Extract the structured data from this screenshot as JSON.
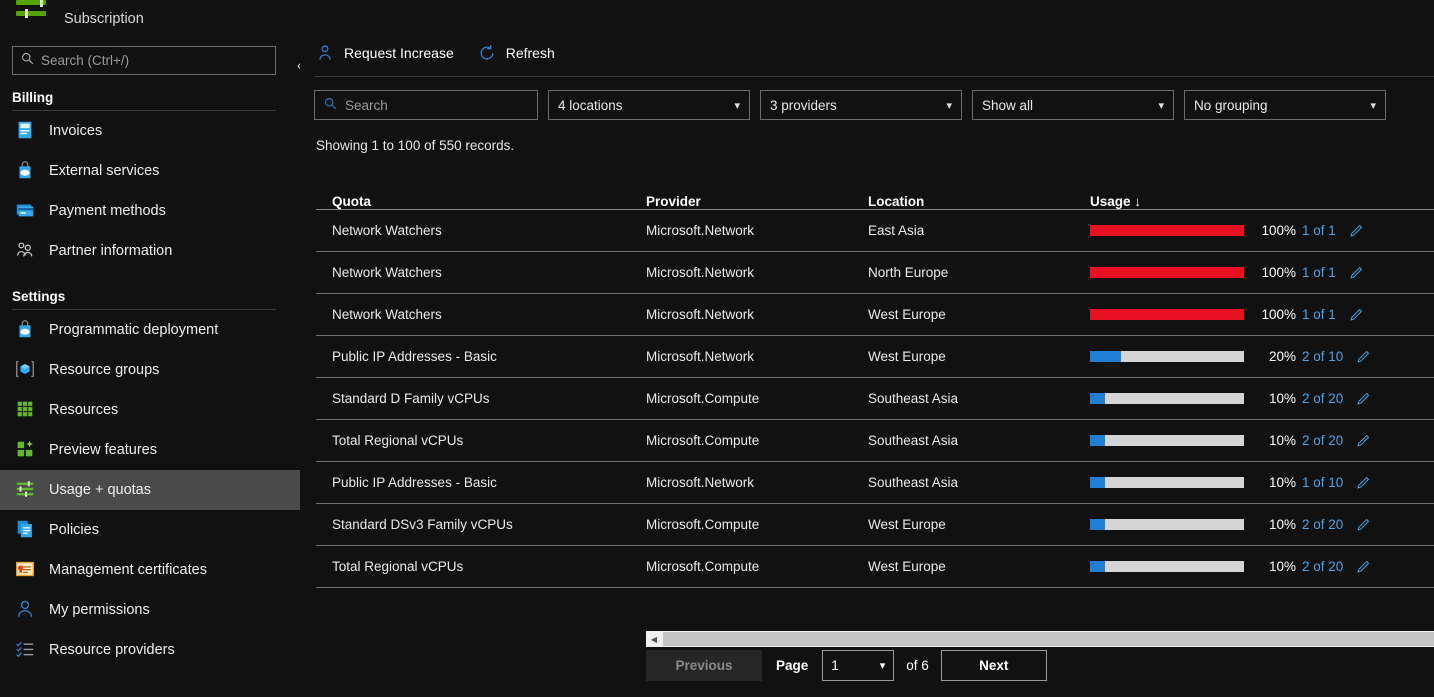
{
  "sidebar": {
    "subscription_label": "Subscription",
    "search_placeholder": "Search (Ctrl+/)",
    "search_value": "",
    "collapse_glyph": "«",
    "groups": [
      {
        "title": "Billing",
        "items": [
          {
            "label": "Invoices",
            "icon": "invoice-icon"
          },
          {
            "label": "External services",
            "icon": "external-services-icon"
          },
          {
            "label": "Payment methods",
            "icon": "payment-methods-icon"
          },
          {
            "label": "Partner information",
            "icon": "partner-information-icon"
          }
        ]
      },
      {
        "title": "Settings",
        "items": [
          {
            "label": "Programmatic deployment",
            "icon": "programmatic-deployment-icon"
          },
          {
            "label": "Resource groups",
            "icon": "resource-groups-icon"
          },
          {
            "label": "Resources",
            "icon": "resources-icon"
          },
          {
            "label": "Preview features",
            "icon": "preview-features-icon"
          },
          {
            "label": "Usage + quotas",
            "icon": "usage-quotas-icon",
            "selected": true
          },
          {
            "label": "Policies",
            "icon": "policies-icon"
          },
          {
            "label": "Management certificates",
            "icon": "management-certificates-icon"
          },
          {
            "label": "My permissions",
            "icon": "my-permissions-icon"
          },
          {
            "label": "Resource providers",
            "icon": "resource-providers-icon"
          }
        ]
      }
    ]
  },
  "toolbar": {
    "request_increase_label": "Request Increase",
    "refresh_label": "Refresh"
  },
  "filters": {
    "search_placeholder": "Search",
    "search_value": "",
    "locations": "4 locations",
    "providers": "3 providers",
    "show": "Show all",
    "grouping": "No grouping"
  },
  "records_text": "Showing 1 to 100 of 550 records.",
  "table": {
    "columns": [
      "Quota",
      "Provider",
      "Location",
      "Usage ↓"
    ],
    "rows": [
      {
        "quota": "Network Watchers",
        "provider": "Microsoft.Network",
        "location": "East Asia",
        "percent": "100%",
        "pct_value": 100,
        "fraction": "1 of 1",
        "color": "#e81123"
      },
      {
        "quota": "Network Watchers",
        "provider": "Microsoft.Network",
        "location": "North Europe",
        "percent": "100%",
        "pct_value": 100,
        "fraction": "1 of 1",
        "color": "#e81123"
      },
      {
        "quota": "Network Watchers",
        "provider": "Microsoft.Network",
        "location": "West Europe",
        "percent": "100%",
        "pct_value": 100,
        "fraction": "1 of 1",
        "color": "#e81123"
      },
      {
        "quota": "Public IP Addresses - Basic",
        "provider": "Microsoft.Network",
        "location": "West Europe",
        "percent": "20%",
        "pct_value": 20,
        "fraction": "2 of 10",
        "color": "#1f7fd4"
      },
      {
        "quota": "Standard D Family vCPUs",
        "provider": "Microsoft.Compute",
        "location": "Southeast Asia",
        "percent": "10%",
        "pct_value": 10,
        "fraction": "2 of 20",
        "color": "#1f7fd4"
      },
      {
        "quota": "Total Regional vCPUs",
        "provider": "Microsoft.Compute",
        "location": "Southeast Asia",
        "percent": "10%",
        "pct_value": 10,
        "fraction": "2 of 20",
        "color": "#1f7fd4"
      },
      {
        "quota": "Public IP Addresses - Basic",
        "provider": "Microsoft.Network",
        "location": "Southeast Asia",
        "percent": "10%",
        "pct_value": 10,
        "fraction": "1 of 10",
        "color": "#1f7fd4"
      },
      {
        "quota": "Standard DSv3 Family vCPUs",
        "provider": "Microsoft.Compute",
        "location": "West Europe",
        "percent": "10%",
        "pct_value": 10,
        "fraction": "2 of 20",
        "color": "#1f7fd4"
      },
      {
        "quota": "Total Regional vCPUs",
        "provider": "Microsoft.Compute",
        "location": "West Europe",
        "percent": "10%",
        "pct_value": 10,
        "fraction": "2 of 20",
        "color": "#1f7fd4"
      }
    ]
  },
  "pagination": {
    "previous_label": "Previous",
    "page_label": "Page",
    "page_value": "1",
    "of_label": "of 6",
    "next_label": "Next"
  },
  "colors": {
    "accent_blue": "#4aa3e8",
    "danger_red": "#e81123",
    "bar_track": "#d4d4d4",
    "selected_row": "#4a4a4a"
  }
}
